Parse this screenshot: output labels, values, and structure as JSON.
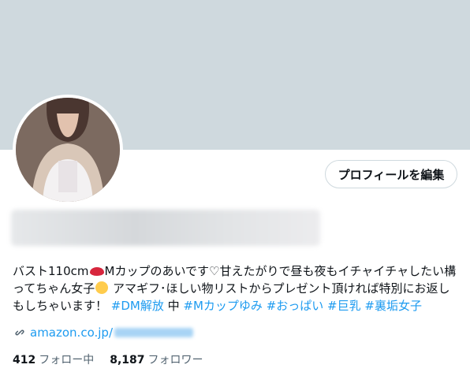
{
  "profile": {
    "edit_button_label": "プロフィールを編集",
    "bio": {
      "text_1": "バスト110cm",
      "text_2": "Mカップのあいです♡甘えたがりで昼も夜もイチャイチャしたい構ってちゃん女子",
      "text_3": " アマギフ･ほしい物リストからプレゼント頂ければ特別にお返しもしちゃいます！ ",
      "hashtag_dm": "#DM解放",
      "middle": " 中 ",
      "hashtag_m": "#Mカップゆみ",
      "hashtag_oppai": "#おっぱい",
      "hashtag_kyonyu": "#巨乳",
      "hashtag_uraaka": "#裏垢女子"
    },
    "link": {
      "icon": "link-icon",
      "text": "amazon.co.jp/"
    },
    "stats": {
      "following_count": "412",
      "following_label": "フォロー中",
      "followers_count": "8,187",
      "followers_label": "フォロワー"
    }
  },
  "colors": {
    "banner": "#cfd9de",
    "link": "#1d9bf0",
    "text": "#0f1419",
    "muted": "#536471"
  }
}
